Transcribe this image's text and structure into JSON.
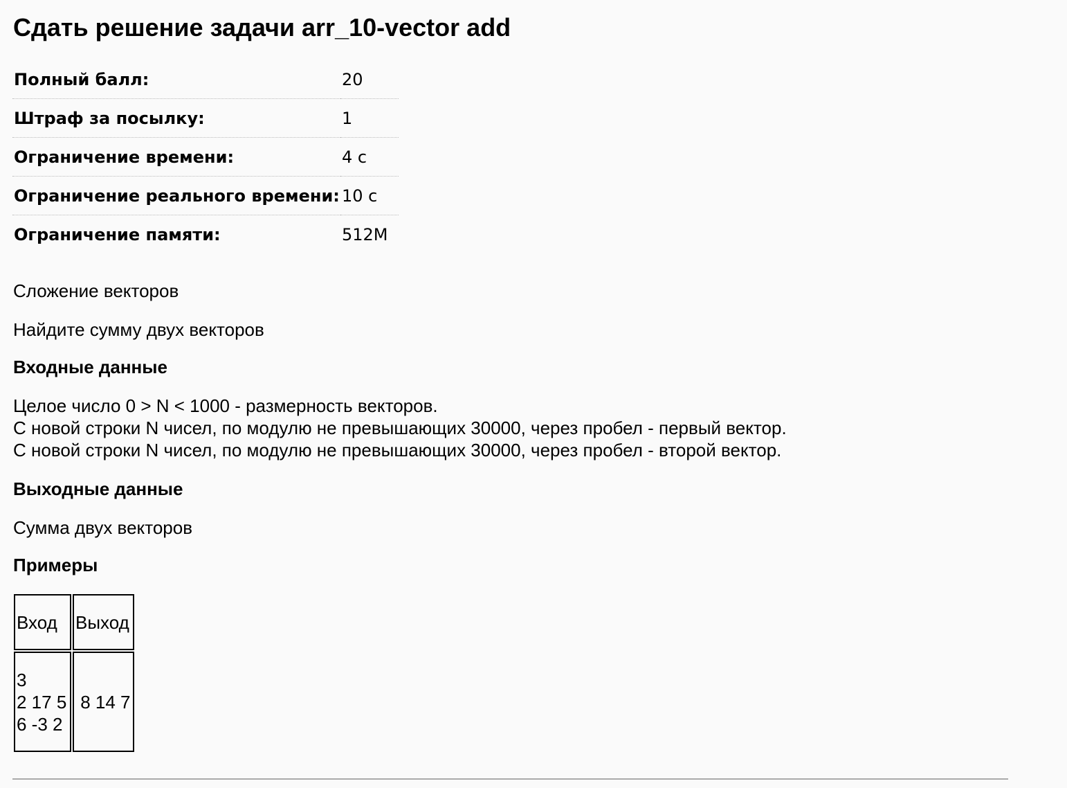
{
  "title": "Сдать решение задачи arr_10-vector add",
  "info": [
    {
      "label": "Полный балл:",
      "value": "20"
    },
    {
      "label": "Штраф за посылку:",
      "value": "1"
    },
    {
      "label": "Ограничение времени:",
      "value": "4 с"
    },
    {
      "label": "Ограничение реального времени:",
      "value": "10 с"
    },
    {
      "label": "Ограничение памяти:",
      "value": "512M"
    }
  ],
  "statement": {
    "name": "Сложение векторов",
    "legend": "Найдите сумму двух векторов",
    "input_heading": "Входные данные",
    "input_lines": [
      "Целое число 0 > N < 1000 - размерность векторов.",
      "С новой строки N чисел, по модулю не превышающих 30000, через пробел - первый вектор.",
      "С новой строки N чисел, по модулю не превышающих 30000, через пробел - второй вектор."
    ],
    "output_heading": "Выходные данные",
    "output_text": "Сумма двух векторов",
    "examples_heading": "Примеры",
    "examples": {
      "headers": [
        "Вход",
        "Выход"
      ],
      "input": "3\n2 17 5\n6 -3 2",
      "output": " 8 14 7"
    }
  }
}
